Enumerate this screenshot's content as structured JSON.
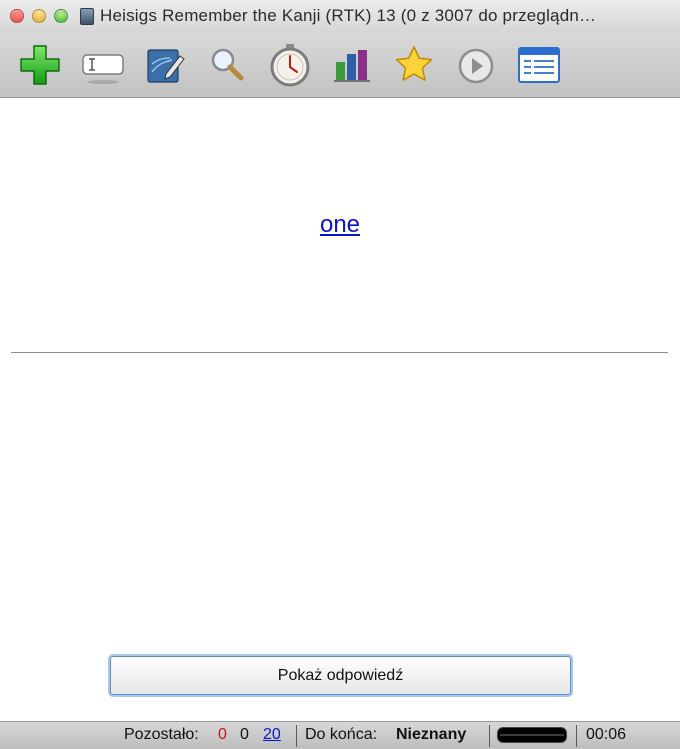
{
  "window": {
    "title": "Heisigs Remember the Kanji (RTK) 13 (0 z 3007 do przeglądn…"
  },
  "toolbar": {
    "icons": [
      "add-icon",
      "text-field-icon",
      "edit-icon",
      "search-icon",
      "timer-icon",
      "stats-icon",
      "star-icon",
      "play-icon",
      "list-icon"
    ]
  },
  "card": {
    "question": "one",
    "show_answer_label": "Pokaż odpowiedź"
  },
  "status": {
    "remaining_label": "Pozostało:",
    "count_new": "0",
    "count_learning": "0",
    "count_review": "20",
    "eta_label": "Do końca:",
    "eta_value": "Nieznany",
    "progress": 1.0,
    "timer": "00:06"
  },
  "colors": {
    "link_blue": "#0a14c8",
    "count_red": "#c81414",
    "add_green": "#2db82d"
  }
}
